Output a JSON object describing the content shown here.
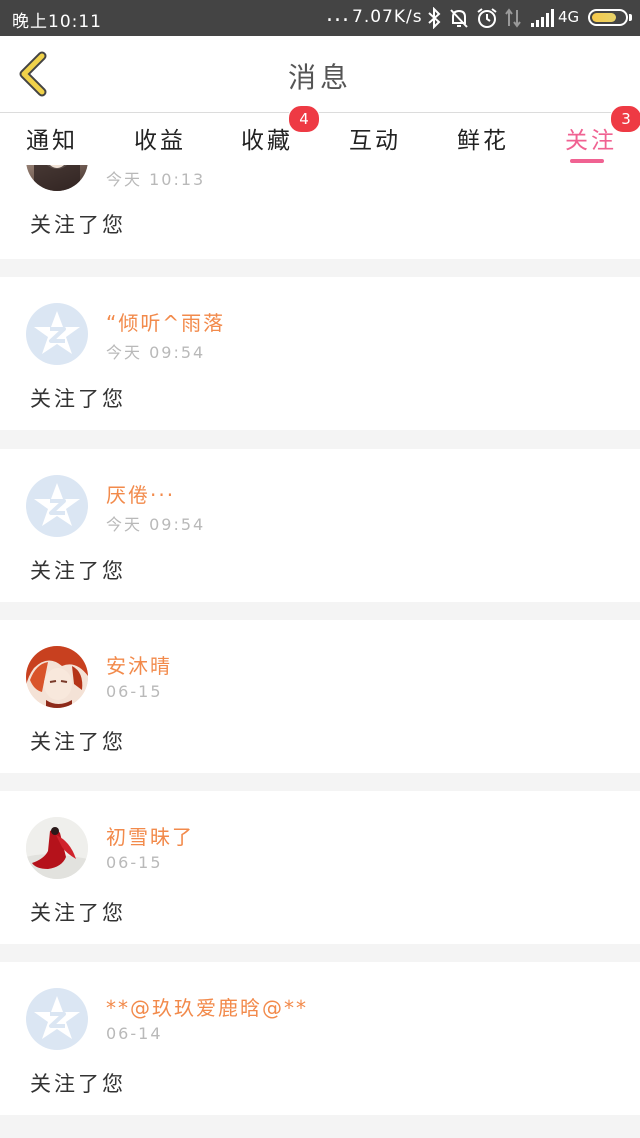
{
  "status_bar": {
    "time": "晚上10:11",
    "dots": "...",
    "speed": "7.07K/s",
    "network": "4G",
    "icons": [
      "bluetooth-icon",
      "mute-bell-icon",
      "alarm-icon",
      "data-arrows-icon",
      "signal-icon",
      "battery-icon"
    ],
    "battery_level": 0.75
  },
  "header": {
    "back_icon": "chevron-left-icon",
    "title": "消息",
    "accent_color": "#f0d24a"
  },
  "tabs": [
    {
      "label": "通知",
      "badge": ""
    },
    {
      "label": "收益",
      "badge": ""
    },
    {
      "label": "收藏",
      "badge": "4"
    },
    {
      "label": "互动",
      "badge": ""
    },
    {
      "label": "鲜花",
      "badge": ""
    },
    {
      "label": "关注",
      "badge": "3",
      "active": true
    }
  ],
  "colors": {
    "active_tab": "#f06292",
    "username": "#f28a4b",
    "badge": "#ee3a44"
  },
  "messages": [
    {
      "name": "",
      "time": "今天 10:13",
      "action": "关注了您",
      "avatar": "photo-avatar"
    },
    {
      "name": "“倾听^雨落",
      "time": "今天 09:54",
      "action": "关注了您",
      "avatar": "default-avatar"
    },
    {
      "name": "厌倦···",
      "time": "今天 09:54",
      "action": "关注了您",
      "avatar": "default-avatar"
    },
    {
      "name": "安沐晴",
      "time": "06-15",
      "action": "关注了您",
      "avatar": "anime-avatar"
    },
    {
      "name": "初雪昧了",
      "time": "06-15",
      "action": "关注了您",
      "avatar": "red-figure-avatar"
    },
    {
      "name": "**@玖玖爱鹿晗@**",
      "time": "06-14",
      "action": "关注了您",
      "avatar": "default-avatar"
    }
  ]
}
